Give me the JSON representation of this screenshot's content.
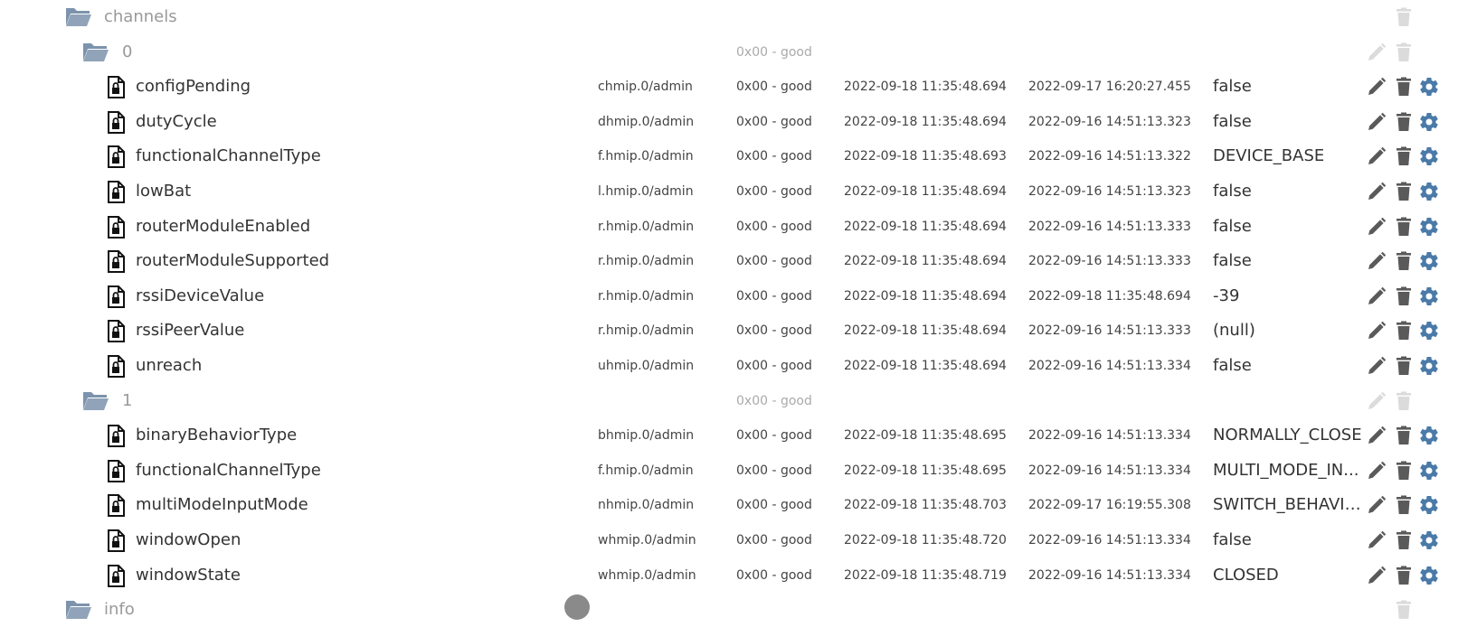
{
  "colors": {
    "folder": "#7d93ad",
    "action": "#5a5a5a",
    "settings": "#4a7aa8",
    "dim": "#cccccc"
  },
  "rows": [
    {
      "type": "folder",
      "level": 0,
      "name": "channels",
      "quality": "",
      "actions": [
        "delete-dim"
      ]
    },
    {
      "type": "folder",
      "level": 1,
      "name": "0",
      "quality": "0x00 - good",
      "actions": [
        "edit-dim",
        "delete-dim"
      ]
    },
    {
      "type": "state",
      "name": "configPending",
      "role": "chmip.0/admin",
      "quality": "0x00 - good",
      "ts": "2022-09-18 11:35:48.694",
      "lc": "2022-09-17 16:20:27.455",
      "value": "false"
    },
    {
      "type": "state",
      "name": "dutyCycle",
      "role": "dhmip.0/admin",
      "quality": "0x00 - good",
      "ts": "2022-09-18 11:35:48.694",
      "lc": "2022-09-16 14:51:13.323",
      "value": "false"
    },
    {
      "type": "state",
      "name": "functionalChannelType",
      "role": "f.hmip.0/admin",
      "quality": "0x00 - good",
      "ts": "2022-09-18 11:35:48.693",
      "lc": "2022-09-16 14:51:13.322",
      "value": "DEVICE_BASE"
    },
    {
      "type": "state",
      "name": "lowBat",
      "role": "l.hmip.0/admin",
      "quality": "0x00 - good",
      "ts": "2022-09-18 11:35:48.694",
      "lc": "2022-09-16 14:51:13.323",
      "value": "false"
    },
    {
      "type": "state",
      "name": "routerModuleEnabled",
      "role": "r.hmip.0/admin",
      "quality": "0x00 - good",
      "ts": "2022-09-18 11:35:48.694",
      "lc": "2022-09-16 14:51:13.333",
      "value": "false"
    },
    {
      "type": "state",
      "name": "routerModuleSupported",
      "role": "r.hmip.0/admin",
      "quality": "0x00 - good",
      "ts": "2022-09-18 11:35:48.694",
      "lc": "2022-09-16 14:51:13.333",
      "value": "false"
    },
    {
      "type": "state",
      "name": "rssiDeviceValue",
      "role": "r.hmip.0/admin",
      "quality": "0x00 - good",
      "ts": "2022-09-18 11:35:48.694",
      "lc": "2022-09-18 11:35:48.694",
      "value": "-39"
    },
    {
      "type": "state",
      "name": "rssiPeerValue",
      "role": "r.hmip.0/admin",
      "quality": "0x00 - good",
      "ts": "2022-09-18 11:35:48.694",
      "lc": "2022-09-16 14:51:13.333",
      "value": "(null)"
    },
    {
      "type": "state",
      "name": "unreach",
      "role": "uhmip.0/admin",
      "quality": "0x00 - good",
      "ts": "2022-09-18 11:35:48.694",
      "lc": "2022-09-16 14:51:13.334",
      "value": "false"
    },
    {
      "type": "folder",
      "level": 1,
      "name": "1",
      "quality": "0x00 - good",
      "actions": [
        "edit-dim",
        "delete-dim"
      ]
    },
    {
      "type": "state",
      "name": "binaryBehaviorType",
      "role": "bhmip.0/admin",
      "quality": "0x00 - good",
      "ts": "2022-09-18 11:35:48.695",
      "lc": "2022-09-16 14:51:13.334",
      "value": "NORMALLY_CLOSE"
    },
    {
      "type": "state",
      "name": "functionalChannelType",
      "role": "f.hmip.0/admin",
      "quality": "0x00 - good",
      "ts": "2022-09-18 11:35:48.695",
      "lc": "2022-09-16 14:51:13.334",
      "value": "MULTI_MODE_IN..."
    },
    {
      "type": "state",
      "name": "multiModeInputMode",
      "role": "nhmip.0/admin",
      "quality": "0x00 - good",
      "ts": "2022-09-18 11:35:48.703",
      "lc": "2022-09-17 16:19:55.308",
      "value": "SWITCH_BEHAVIOR"
    },
    {
      "type": "state",
      "name": "windowOpen",
      "role": "whmip.0/admin",
      "quality": "0x00 - good",
      "ts": "2022-09-18 11:35:48.720",
      "lc": "2022-09-16 14:51:13.334",
      "value": "false"
    },
    {
      "type": "state",
      "name": "windowState",
      "role": "whmip.0/admin",
      "quality": "0x00 - good",
      "ts": "2022-09-18 11:35:48.719",
      "lc": "2022-09-16 14:51:13.334",
      "value": "CLOSED"
    }
  ],
  "partial_row": {
    "name": "info"
  }
}
